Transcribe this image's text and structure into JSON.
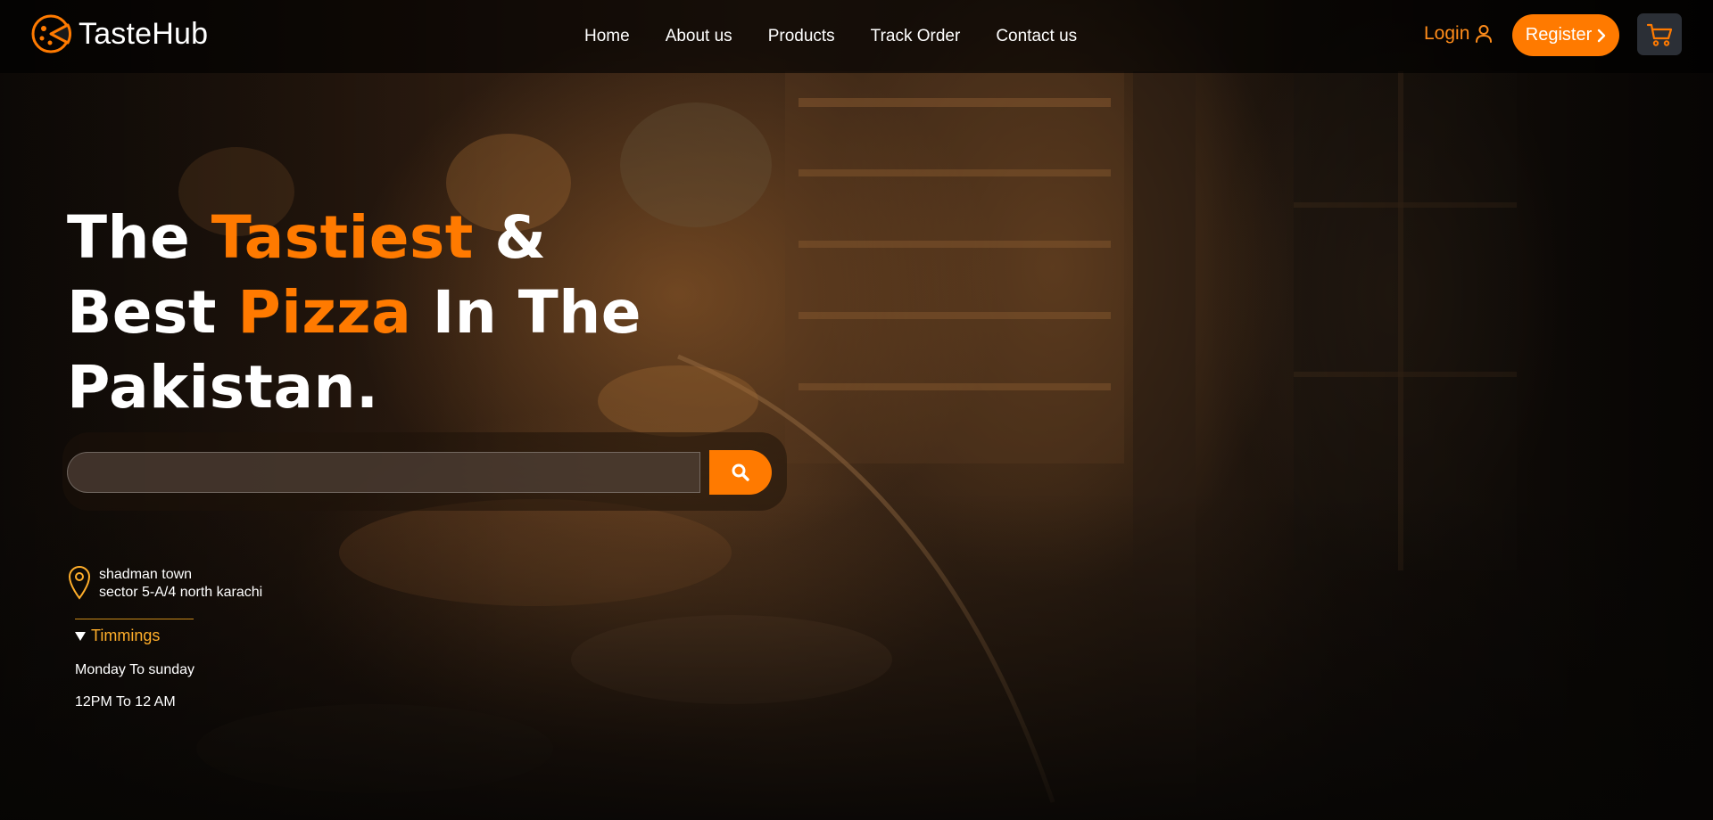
{
  "brand": {
    "name": "TasteHub",
    "logo_icon": "pizza-logo-icon"
  },
  "nav": {
    "links": [
      {
        "label": "Home"
      },
      {
        "label": "About us"
      },
      {
        "label": "Products"
      },
      {
        "label": "Track Order"
      },
      {
        "label": "Contact us"
      }
    ]
  },
  "auth": {
    "login_label": "Login",
    "login_icon": "user-icon",
    "register_label": "Register",
    "register_icon": "chevron-right-icon"
  },
  "cart": {
    "icon": "cart-icon"
  },
  "hero": {
    "line1_part1": "The ",
    "line1_highlight": "Tastiest",
    "line1_part2": " &",
    "line2_part1": "Best ",
    "line2_highlight": "Pizza",
    "line2_part2": " In The",
    "line3": "Pakistan."
  },
  "search": {
    "value": "",
    "placeholder": "",
    "icon": "search-icon"
  },
  "location": {
    "icon": "map-pin-icon",
    "line1": "shadman town",
    "line2": "sector 5-A/4 north karachi"
  },
  "timings": {
    "label": "Timmings",
    "days": "Monday To sunday",
    "hours": "12PM To 12 AM",
    "toggle_icon": "triangle-down-icon"
  },
  "colors": {
    "accent": "#ff7a00",
    "gold": "#ffae2a",
    "nav_bg": "#000000",
    "cart_bg": "#2b2f36"
  }
}
